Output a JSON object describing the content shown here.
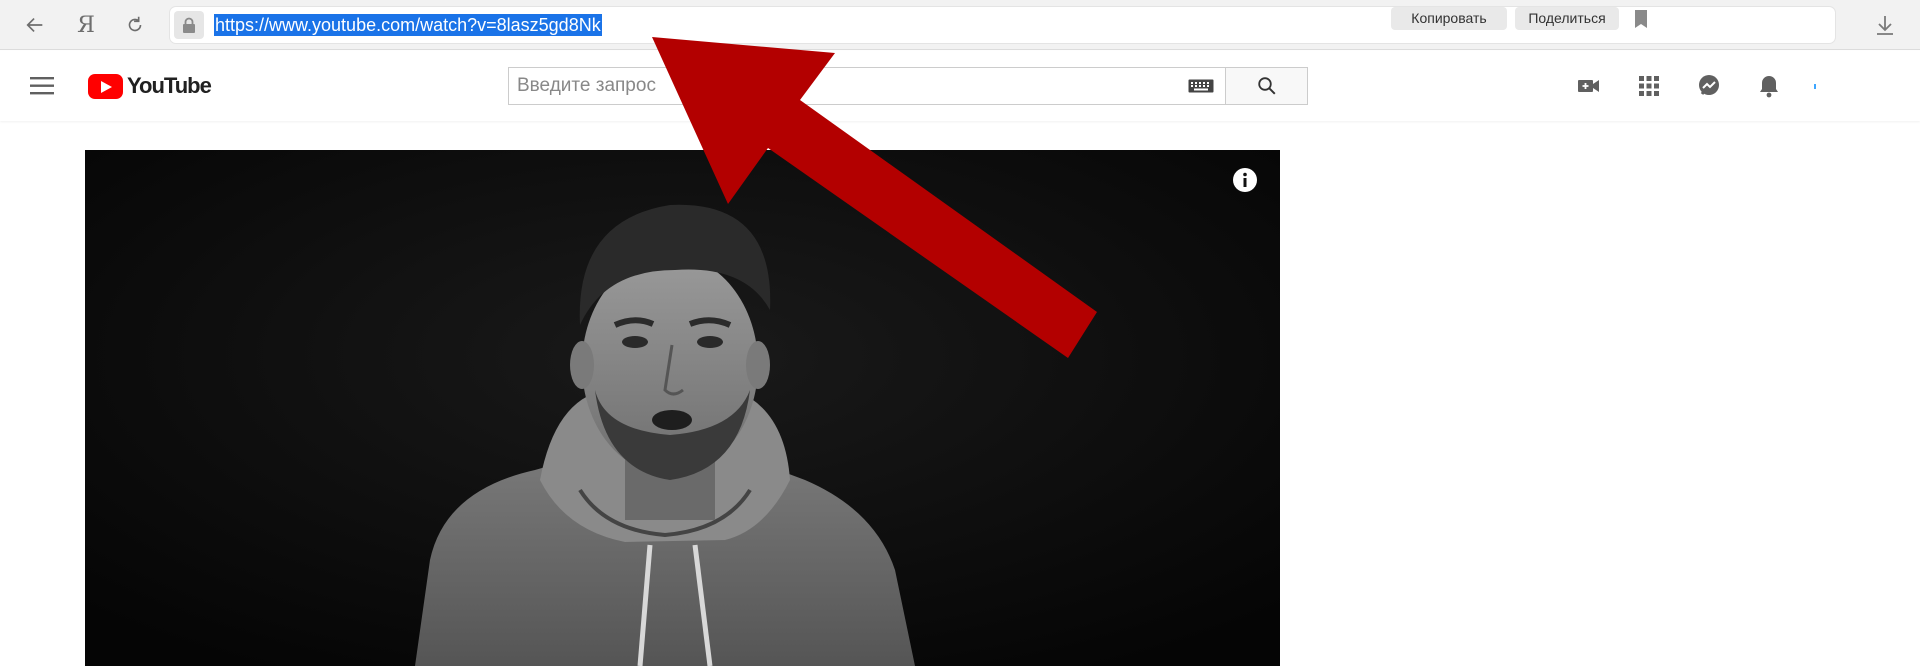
{
  "browser": {
    "nav_ya_label": "Я",
    "url": "https://www.youtube.com/watch?v=8lasz5gd8Nk",
    "copy_label": "Копировать",
    "share_label": "Поделиться"
  },
  "youtube": {
    "logo_text": "YouTube",
    "search_placeholder": "Введите запрос",
    "icons": [
      "menu-icon",
      "keyboard-icon",
      "search-icon",
      "create-video-icon",
      "apps-icon",
      "messages-icon",
      "notifications-icon",
      "info-icon"
    ]
  },
  "colors": {
    "accent_arrow": "#b30000",
    "youtube_red": "#ff0000",
    "url_selection": "#1a73e8"
  }
}
